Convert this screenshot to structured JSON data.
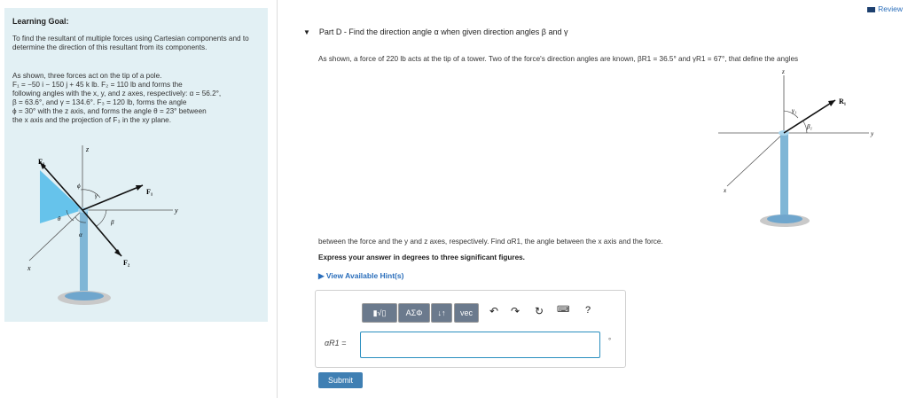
{
  "review": {
    "label": "Review"
  },
  "learning": {
    "title": "Learning Goal:",
    "goal_text": "To find the resultant of multiple forces using Cartesian components and to determine the direction of this resultant from its components.",
    "problem_lines": [
      "As shown, three forces act on the tip of a pole.",
      "F₁ = −50 i − 150 j + 45 k lb. F₂ = 110 lb and forms the",
      "following angles with the x, y, and z axes, respectively: α = 56.2°,",
      "β = 63.6°, and γ = 134.6°. F₃ = 120 lb, forms the angle",
      "ϕ = 30° with the z axis, and forms the angle θ = 23° between",
      "the x axis and the projection of F₃ in the xy plane."
    ],
    "figure_labels": {
      "f3": "F₃",
      "f1": "F₁",
      "f2": "F₂",
      "z": "z",
      "y": "y",
      "x": "x",
      "phi": "ϕ",
      "theta": "θ",
      "gamma": "γ",
      "beta": "β",
      "alpha": "α"
    }
  },
  "partd": {
    "title": "Part D - Find the direction angle α when given direction angles β and γ",
    "intro": "As shown, a force of 220 lb acts at the tip of a tower. Two of the force's direction angles are known, βR1 = 36.5° and γR1 = 67°, that define the angles",
    "cont": "between the force and the y and z axes, respectively. Find αR1, the angle between the x axis and the force.",
    "instruction": "Express your answer in degrees to three significant figures.",
    "hint_label": "View Available Hint(s)",
    "figure_labels": {
      "z": "z",
      "y": "y",
      "x": "x",
      "r1": "R₁",
      "gamma": "γ₁",
      "beta": "β₁"
    }
  },
  "toolbar": {
    "template": "▮√▯",
    "greek": "ΑΣΦ",
    "arrows": "↓↑",
    "vec": "vec",
    "help": "?"
  },
  "answer": {
    "label": "αR1 =",
    "value": "",
    "unit_mark": "°"
  },
  "submit": {
    "label": "Submit"
  }
}
